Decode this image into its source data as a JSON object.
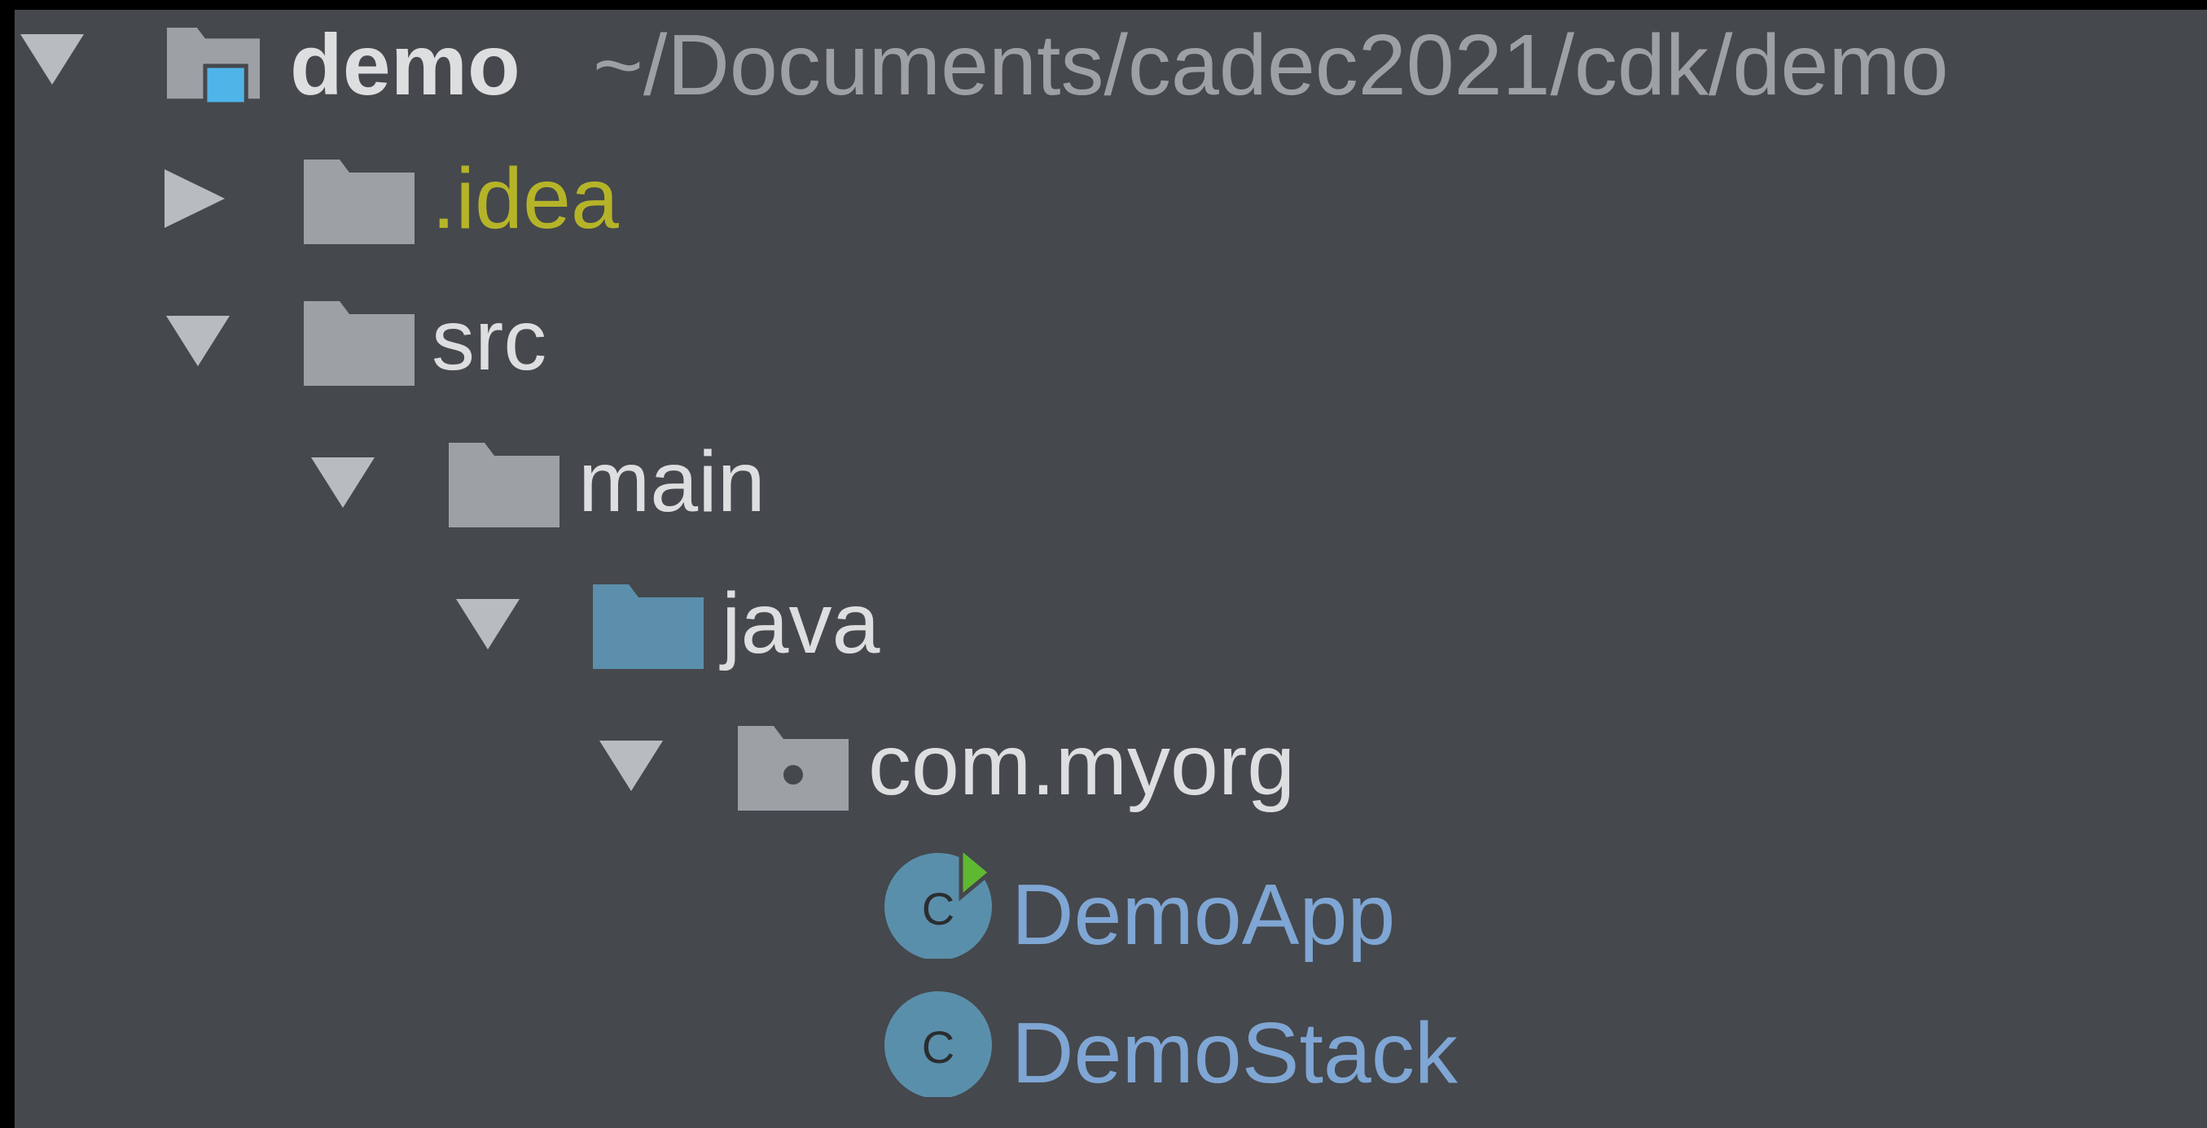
{
  "project_tree": {
    "root": {
      "name": "demo",
      "path": "~/Documents/cadec2021/cdk/demo",
      "expanded": true,
      "icon": "project-folder-icon"
    },
    "items": [
      {
        "name": ".idea",
        "expanded": false,
        "icon": "folder-icon",
        "color": "#b5b428"
      },
      {
        "name": "src",
        "expanded": true,
        "icon": "folder-icon"
      },
      {
        "name": "main",
        "expanded": true,
        "icon": "folder-icon"
      },
      {
        "name": "java",
        "expanded": true,
        "icon": "source-folder-icon",
        "color": "#5b8fac"
      },
      {
        "name": "com.myorg",
        "expanded": true,
        "icon": "package-icon"
      },
      {
        "name": "DemoApp",
        "icon": "runnable-class-icon",
        "color": "#7fa6d4"
      },
      {
        "name": "DemoStack",
        "icon": "class-icon",
        "color": "#7fa6d4"
      }
    ],
    "class_icon_letter": "C"
  },
  "colors": {
    "background": "#45484c",
    "text": "#dcdee0",
    "path_text": "#9ea1a4",
    "folder": "#9da1a6",
    "source_folder": "#5b8fac",
    "class_icon": "#5a8fab",
    "run_marker": "#5fb832",
    "module_marker": "#4fb4e8"
  }
}
